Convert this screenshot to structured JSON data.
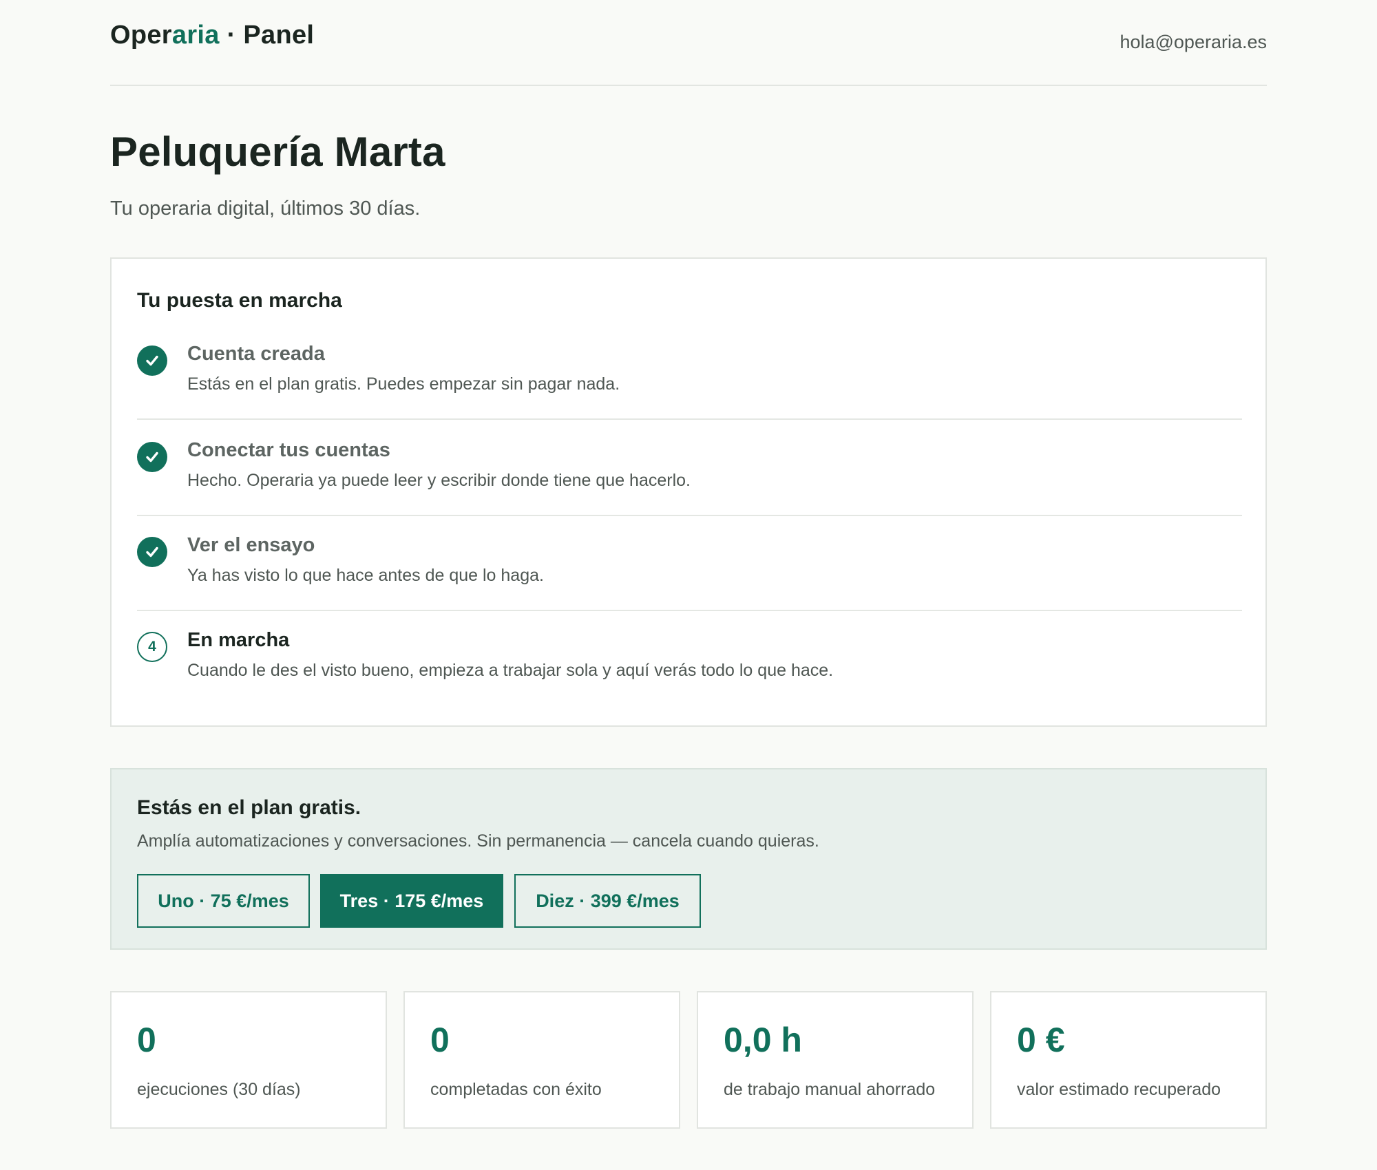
{
  "header": {
    "brand_prefix": "Oper",
    "brand_accent": "aria",
    "brand_suffix": " · Panel",
    "email": "hola@operaria.es"
  },
  "page": {
    "title": "Peluquería Marta",
    "subtitle": "Tu operaria digital, últimos 30 días."
  },
  "onboarding": {
    "title": "Tu puesta en marcha",
    "steps": [
      {
        "title": "Cuenta creada",
        "desc": "Estás en el plan gratis. Puedes empezar sin pagar nada.",
        "status": "done",
        "icon": "check-icon"
      },
      {
        "title": "Conectar tus cuentas",
        "desc": "Hecho. Operaria ya puede leer y escribir donde tiene que hacerlo.",
        "status": "done",
        "icon": "check-icon"
      },
      {
        "title": "Ver el ensayo",
        "desc": "Ya has visto lo que hace antes de que lo haga.",
        "status": "done",
        "icon": "check-icon"
      },
      {
        "number": "4",
        "title": "En marcha",
        "desc": "Cuando le des el visto bueno, empieza a trabajar sola y aquí verás todo lo que hace.",
        "status": "pending"
      }
    ]
  },
  "plan": {
    "title": "Estás en el plan gratis.",
    "description": "Amplía automatizaciones y conversaciones. Sin permanencia — cancela cuando quieras.",
    "options": [
      {
        "label": "Uno · 75 €/mes",
        "highlighted": false
      },
      {
        "label": "Tres · 175 €/mes",
        "highlighted": true
      },
      {
        "label": "Diez · 399 €/mes",
        "highlighted": false
      }
    ]
  },
  "stats": [
    {
      "value": "0",
      "label": "ejecuciones (30 días)"
    },
    {
      "value": "0",
      "label": "completadas con éxito"
    },
    {
      "value": "0,0 h",
      "label": "de trabajo manual ahorrado"
    },
    {
      "value": "0 €",
      "label": "valor estimado recuperado"
    }
  ],
  "colors": {
    "accent": "#11705b",
    "background": "#f9faf7",
    "plan_background": "#e8f0ec",
    "text": "#1b2520",
    "muted_text": "#4f5753"
  }
}
